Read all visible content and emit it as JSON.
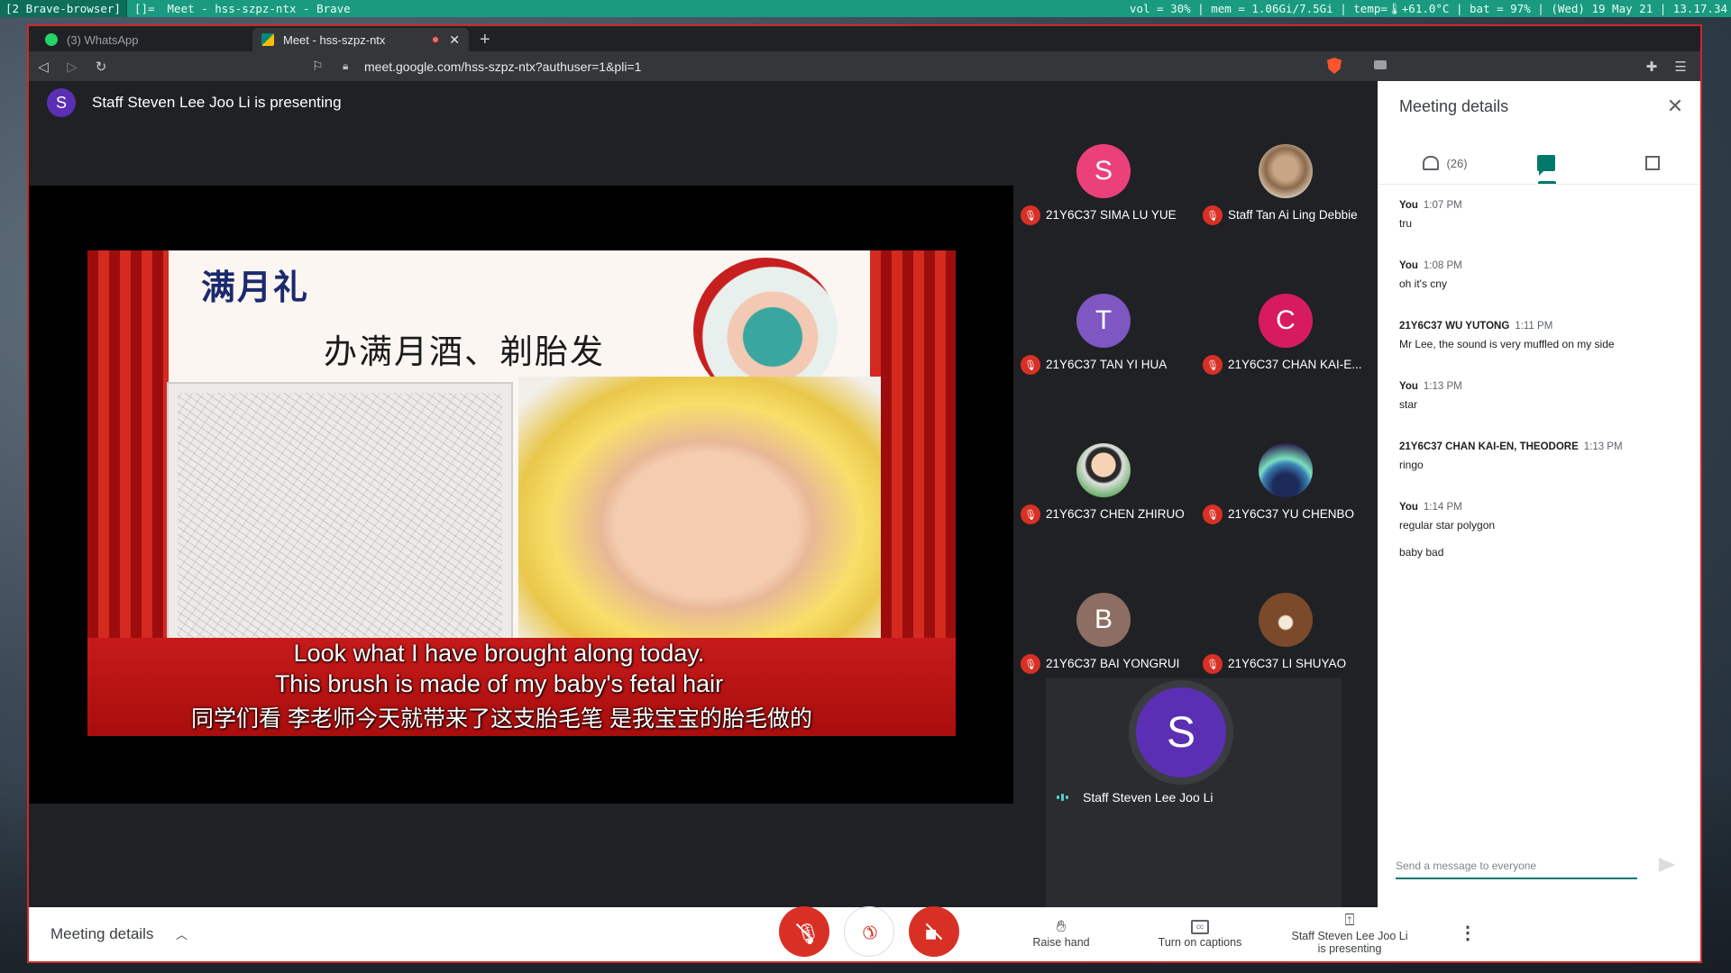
{
  "wm": {
    "tag": "[2 Brave-browser]",
    "layout": "[]=",
    "title": "Meet - hss-szpz-ntx - Brave",
    "status": "vol = 30% | mem = 1.06Gi/7.5Gi | temp=🌡+61.0°C | bat = 97% | (Wed) 19 May 21 | 13.17.34"
  },
  "tabs": [
    {
      "label": "(3) WhatsApp",
      "icon": "whatsapp-icon",
      "color": "#25d366"
    },
    {
      "label": "Meet - hss-szpz-ntx",
      "icon": "meet-icon",
      "color": "#00897b"
    }
  ],
  "url": "meet.google.com/hss-szpz-ntx?authuser=1&pli=1",
  "presenter": {
    "initial": "S",
    "text": "Staff Steven Lee Joo Li is presenting"
  },
  "slide": {
    "title_cn": "满月礼",
    "heading_cn": "办满月酒、剃胎发",
    "sub1": "Look what I have brought along today.",
    "sub2": "This brush is made of my baby's fetal hair",
    "sub3": "同学们看 李老师今天就带来了这支胎毛笔 是我宝宝的胎毛做的"
  },
  "participants": [
    {
      "name": "21Y6C37 SIMA LU YUE",
      "initial": "S",
      "color": "#ec407a"
    },
    {
      "name": "Staff Tan Ai Ling Debbie",
      "initial": "",
      "image": "cat-avatar"
    },
    {
      "name": "21Y6C37 TAN YI HUA",
      "initial": "T",
      "color": "#7e57c2"
    },
    {
      "name": "21Y6C37 CHAN KAI-E...",
      "initial": "C",
      "color": "#d81b60"
    },
    {
      "name": "21Y6C37 CHEN ZHIRUO",
      "initial": "",
      "image": "cartoon-avatar"
    },
    {
      "name": "21Y6C37 YU CHENBO",
      "initial": "",
      "image": "aurora-avatar"
    },
    {
      "name": "21Y6C37 BAI YONGRUI",
      "initial": "B",
      "color": "#8d6e63"
    },
    {
      "name": "21Y6C37 LI SHUYAO",
      "initial": "",
      "image": "bear-avatar"
    }
  ],
  "self": {
    "initial": "S",
    "name": "Staff Steven Lee Joo Li"
  },
  "panel": {
    "title": "Meeting details",
    "people_count": "(26)",
    "messages": [
      {
        "sender": "You",
        "time": "1:07 PM",
        "text": "tru"
      },
      {
        "sender": "You",
        "time": "1:08 PM",
        "text": "oh it's cny"
      },
      {
        "sender": "21Y6C37 WU YUTONG",
        "time": "1:11 PM",
        "text": "Mr Lee, the sound is very muffled on my side"
      },
      {
        "sender": "You",
        "time": "1:13 PM",
        "text": "star"
      },
      {
        "sender": "21Y6C37 CHAN KAI-EN, THEODORE",
        "time": "1:13 PM",
        "text": "ringo"
      },
      {
        "sender": "You",
        "time": "1:14 PM",
        "text": "regular star polygon"
      }
    ],
    "extra_message": "baby bad",
    "compose_placeholder": "Send a message to everyone"
  },
  "bottombar": {
    "meeting_details": "Meeting details",
    "raise_hand": "Raise hand",
    "captions": "Turn on captions",
    "presenting_line1": "Staff Steven Lee Joo Li",
    "presenting_line2": "is presenting"
  }
}
